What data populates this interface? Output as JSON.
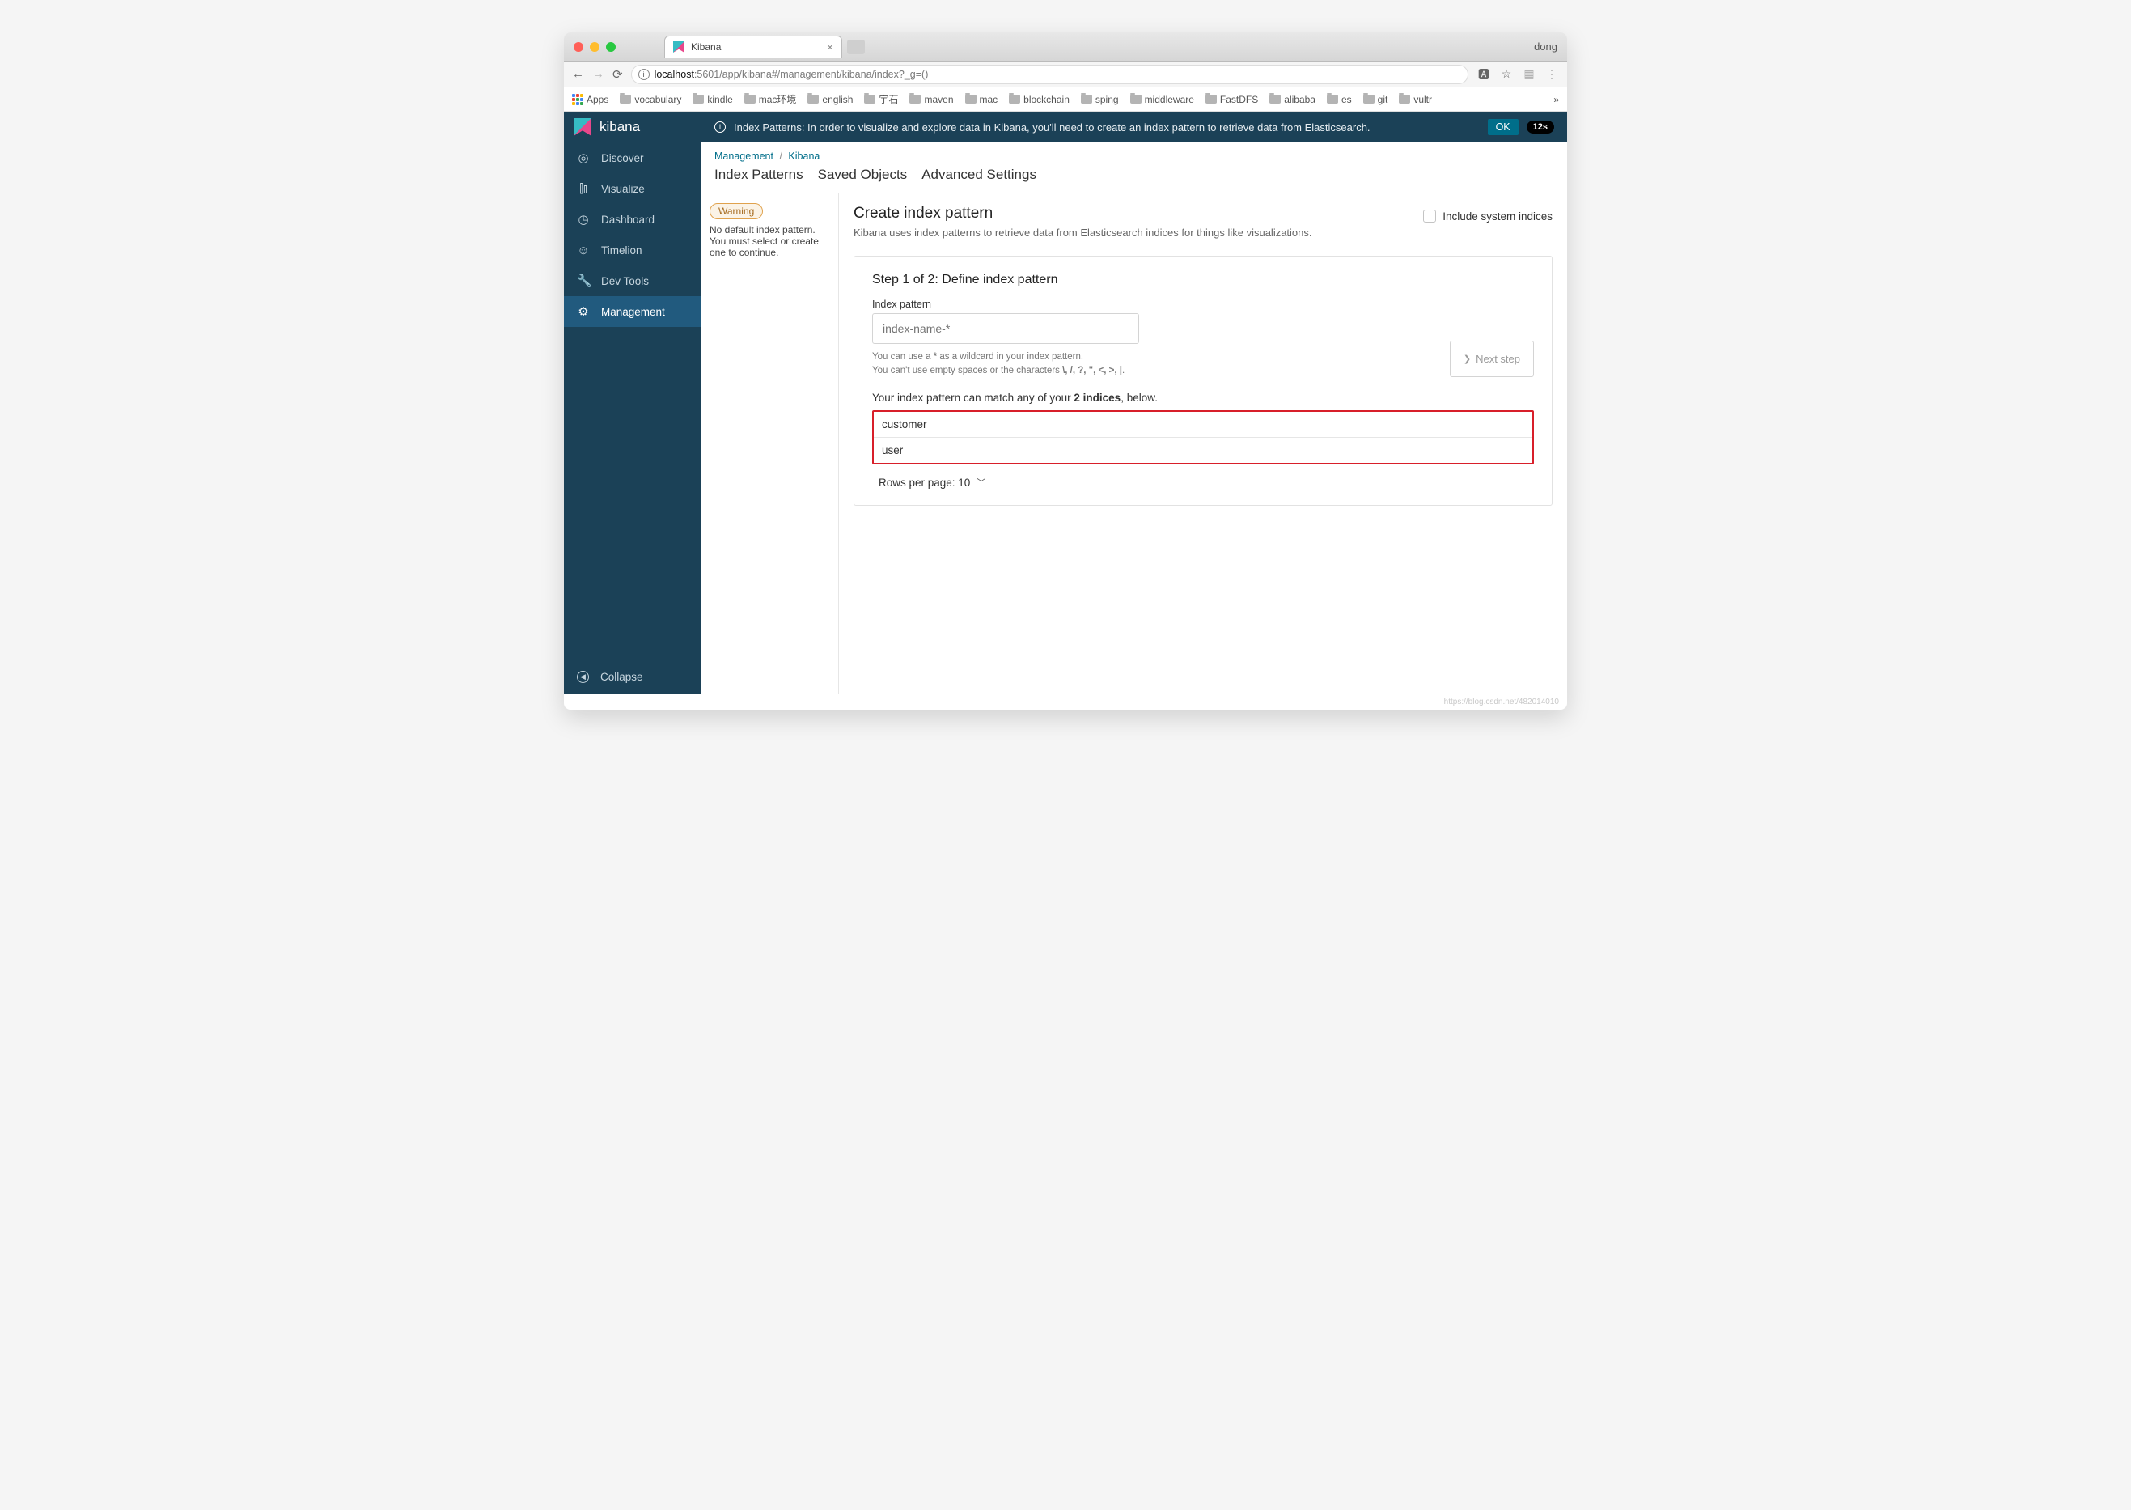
{
  "titlebar": {
    "tab_title": "Kibana",
    "profile": "dong"
  },
  "toolbar": {
    "url_host": "localhost",
    "url_path": ":5601/app/kibana#/management/kibana/index?_g=()"
  },
  "bookmarks": {
    "apps": "Apps",
    "items": [
      "vocabulary",
      "kindle",
      "mac环境",
      "english",
      "宇石",
      "maven",
      "mac",
      "blockchain",
      "sping",
      "middleware",
      "FastDFS",
      "alibaba",
      "es",
      "git",
      "vultr"
    ],
    "more": "»"
  },
  "app": {
    "brand": "kibana",
    "nav": [
      "Discover",
      "Visualize",
      "Dashboard",
      "Timelion",
      "Dev Tools",
      "Management"
    ],
    "collapse": "Collapse"
  },
  "banner": {
    "text": "Index Patterns: In order to visualize and explore data in Kibana, you'll need to create an index pattern to retrieve data from Elasticsearch.",
    "ok": "OK",
    "timer": "12s"
  },
  "crumbs": {
    "a": "Management",
    "b": "Kibana"
  },
  "tabs": [
    "Index Patterns",
    "Saved Objects",
    "Advanced Settings"
  ],
  "warning": {
    "badge": "Warning",
    "text": "No default index pattern. You must select or create one to continue."
  },
  "create": {
    "title": "Create index pattern",
    "sub": "Kibana uses index patterns to retrieve data from Elasticsearch indices for things like visualizations.",
    "include": "Include system indices"
  },
  "step": {
    "title": "Step 1 of 2: Define index pattern",
    "field_label": "Index pattern",
    "placeholder": "index-name-*",
    "hint1_a": "You can use a ",
    "hint1_b": " as a wildcard in your index pattern.",
    "hint2_a": "You can't use empty spaces or the characters ",
    "hint2_b": "\\, /, ?, \", <, >, |",
    "hint2_c": ".",
    "next": "Next step",
    "match_a": "Your index pattern can match any of your ",
    "match_b": "2 indices",
    "match_c": ", below.",
    "indices": [
      "customer",
      "user"
    ],
    "pager": "Rows per page: 10"
  },
  "watermark": "https://blog.csdn.net/482014010"
}
